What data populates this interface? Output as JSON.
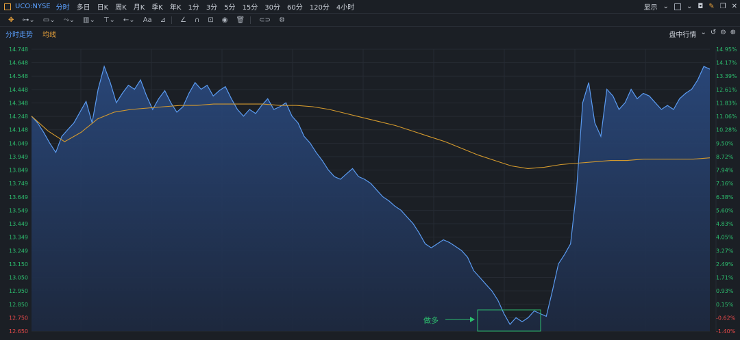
{
  "header": {
    "symbol": "UCO:NYSE",
    "periods": [
      "分时",
      "多日",
      "日K",
      "周K",
      "月K",
      "季K",
      "年K",
      "1分",
      "3分",
      "5分",
      "15分",
      "30分",
      "60分",
      "120分",
      "4小时"
    ],
    "active_period": "分时",
    "display_label": "显示"
  },
  "toolbar": {
    "text_tool": "Aa"
  },
  "subbar": {
    "tab_time": "分时走势",
    "tab_avg": "均线",
    "right_label": "盘中行情"
  },
  "colors": {
    "price_line": "#5b9bf0",
    "avg_line": "#d49a2e",
    "up": "#2dbd6e",
    "down": "#e84a4a",
    "annotation": "#2dbd6e"
  },
  "annotation": {
    "text": "做多"
  },
  "chart_data": {
    "type": "line",
    "y_left_ticks": [
      "14.748",
      "14.648",
      "14.548",
      "14.448",
      "14.348",
      "14.248",
      "14.148",
      "14.049",
      "13.949",
      "13.849",
      "13.749",
      "13.649",
      "13.549",
      "13.449",
      "13.349",
      "13.249",
      "13.150",
      "13.050",
      "12.950",
      "12.850",
      "12.750",
      "12.650"
    ],
    "y_right_ticks": [
      "14.95%",
      "14.17%",
      "13.39%",
      "12.61%",
      "11.83%",
      "11.06%",
      "10.28%",
      "9.50%",
      "8.72%",
      "7.94%",
      "7.16%",
      "6.38%",
      "5.60%",
      "4.83%",
      "4.05%",
      "3.27%",
      "2.49%",
      "1.71%",
      "0.93%",
      "0.15%",
      "-0.62%",
      "-1.40%"
    ],
    "ylim": [
      12.65,
      14.748
    ],
    "series": [
      {
        "values": [
          14.25,
          14.2,
          14.13,
          14.05,
          13.98,
          14.1,
          14.15,
          14.2,
          14.28,
          14.36,
          14.2,
          14.45,
          14.62,
          14.5,
          14.35,
          14.42,
          14.48,
          14.45,
          14.52,
          14.4,
          14.3,
          14.38,
          14.44,
          14.35,
          14.28,
          14.32,
          14.42,
          14.5,
          14.45,
          14.48,
          14.4,
          14.44,
          14.47,
          14.38,
          14.3,
          14.25,
          14.3,
          14.27,
          14.33,
          14.38,
          14.3,
          14.32,
          14.35,
          14.25,
          14.2,
          14.1,
          14.05,
          13.98,
          13.92,
          13.85,
          13.8,
          13.78,
          13.82,
          13.86,
          13.8,
          13.78,
          13.75,
          13.7,
          13.65,
          13.62,
          13.58,
          13.55,
          13.5,
          13.45,
          13.38,
          13.3,
          13.27,
          13.3,
          13.33,
          13.31,
          13.28,
          13.25,
          13.2,
          13.1,
          13.05,
          13.0,
          12.95,
          12.88,
          12.78,
          12.7,
          12.75,
          12.72,
          12.75,
          12.8,
          12.78,
          12.76,
          12.95,
          13.15,
          13.22,
          13.3,
          13.7,
          14.35,
          14.5,
          14.2,
          14.1,
          14.45,
          14.4,
          14.3,
          14.35,
          14.45,
          14.38,
          14.42,
          14.4,
          14.35,
          14.3,
          14.33,
          14.3,
          14.38,
          14.42,
          14.45,
          14.52,
          14.62,
          14.6
        ]
      },
      {
        "values": [
          14.25,
          14.14,
          14.06,
          14.13,
          14.23,
          14.28,
          14.3,
          14.31,
          14.32,
          14.33,
          14.33,
          14.34,
          14.34,
          14.34,
          14.34,
          14.33,
          14.33,
          14.32,
          14.3,
          14.27,
          14.24,
          14.21,
          14.18,
          14.14,
          14.1,
          14.06,
          14.01,
          13.96,
          13.92,
          13.88,
          13.86,
          13.87,
          13.89,
          13.9,
          13.91,
          13.92,
          13.92,
          13.93,
          13.93,
          13.93,
          13.93,
          13.94
        ]
      }
    ]
  }
}
